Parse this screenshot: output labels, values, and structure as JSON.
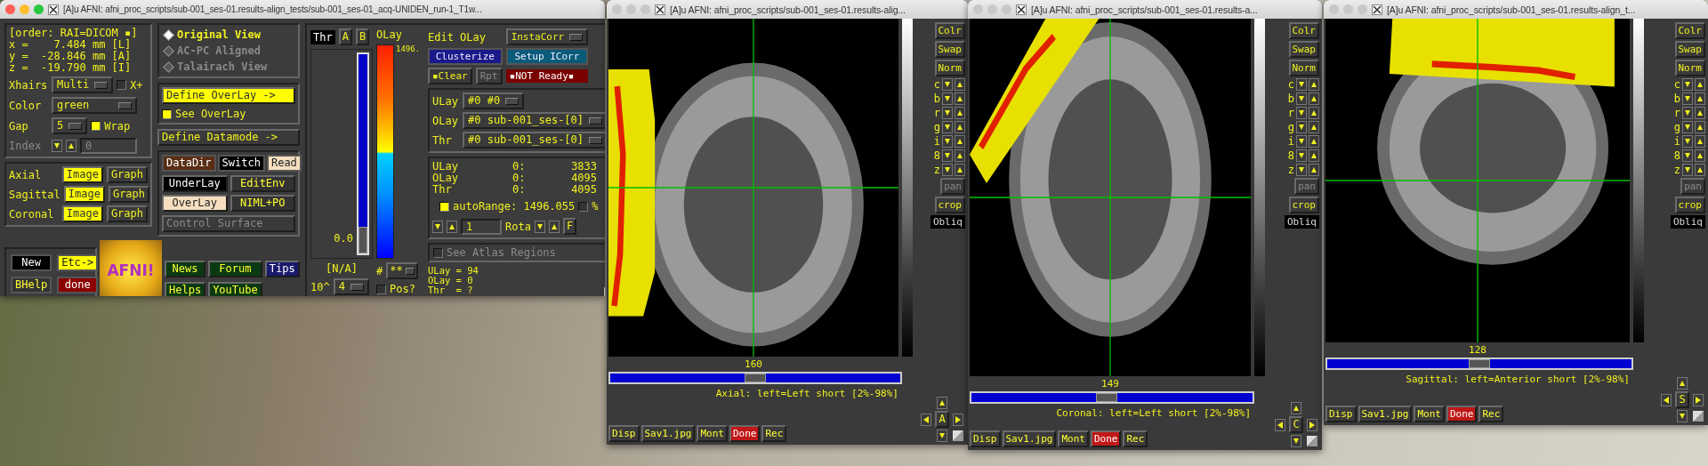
{
  "main_window": {
    "title": "[A]u AFNI: afni_proc_scripts/sub-001_ses-01.results-align_tests/sub-001_ses-01_acq-UNIDEN_run-1_T1w...",
    "coordinates": {
      "order": "[order: RAI=DICOM ▪]",
      "lines": [
        "x =    7.484 mm [L]",
        "y =  -28.846 mm [A]",
        "z =  -19.790 mm [I]"
      ]
    },
    "xhairs": {
      "label": "Xhairs",
      "value": "Multi",
      "option": {
        "label": "X+",
        "checked": false
      }
    },
    "color": {
      "label": "Color",
      "value": "green"
    },
    "gap": {
      "label": "Gap",
      "value": "5",
      "option": {
        "label": "Wrap",
        "checked": true
      }
    },
    "index": {
      "label": "Index",
      "value": "0",
      "disabled": true
    },
    "planes": [
      {
        "label": "Axial",
        "image": {
          "label": "Image",
          "on": true
        },
        "graph": {
          "label": "Graph",
          "on": false
        }
      },
      {
        "label": "Sagittal",
        "image": {
          "label": "Image",
          "on": true
        },
        "graph": {
          "label": "Graph",
          "on": false
        }
      },
      {
        "label": "Coronal",
        "image": {
          "label": "Image",
          "on": true
        },
        "graph": {
          "label": "Graph",
          "on": false
        }
      }
    ],
    "views": [
      {
        "label": "Original View",
        "selected": true,
        "disabled": false
      },
      {
        "label": "AC-PC Aligned",
        "selected": false,
        "disabled": true
      },
      {
        "label": "Talairach View",
        "selected": false,
        "disabled": true
      }
    ],
    "define_overlay": {
      "label": "Define OverLay ->",
      "on": true
    },
    "see_overlay": {
      "label": "See OverLay",
      "checked": true
    },
    "define_datamode": {
      "label": "Define Datamode ->"
    },
    "datamode_buttons": [
      {
        "label": "DataDir",
        "color": "#5a2e14"
      },
      {
        "label": "Switch",
        "color": "#000000"
      },
      {
        "label": "Read",
        "color": "#f5dfc0"
      }
    ],
    "layer_buttons": [
      {
        "label": "UnderLay",
        "color": "#000000"
      },
      {
        "label": "EditEnv",
        "color": "#333333"
      },
      {
        "label": "OverLay",
        "color": "#f5dfc0"
      },
      {
        "label": "NIML+PO",
        "color": "#333333"
      }
    ],
    "control_surface": {
      "label": "Control Surface",
      "disabled": true
    },
    "session_buttons": [
      {
        "label": "New",
        "color": "#000000"
      },
      {
        "label": "Etc->",
        "color": "#ffff00"
      },
      {
        "label": "BHelp",
        "color": "#333333"
      },
      {
        "label": "done",
        "color": "#8b0000"
      }
    ],
    "logo": {
      "text": "AFNI!"
    },
    "help_links": [
      {
        "label": "News",
        "color": "#0b3a12"
      },
      {
        "label": "Forum",
        "color": "#0b3a12"
      },
      {
        "label": "Tips",
        "color": "#1a1a6e"
      },
      {
        "label": "Helps",
        "color": "#0b3a12"
      },
      {
        "label": "YouTube",
        "color": "#0b3a12"
      }
    ],
    "threshold": {
      "label": "Thr",
      "buttons": [
        "A",
        "B"
      ],
      "level": 0,
      "reading": "0.0",
      "pvalue": "[N/A]",
      "exponent_label": "10^",
      "exponent": "4"
    },
    "overlay_bar": {
      "label": "OLay",
      "top_value": "1496.",
      "count_label": "#",
      "count": "**",
      "pos": {
        "label": "Pos?",
        "checked": false
      }
    },
    "edit_overlay": {
      "label": "Edit OLay",
      "instacorr": "InstaCorr",
      "clusterize": "Clusterize",
      "setup_icorr": "Setup ICorr",
      "clear": "▪Clear",
      "rpt": {
        "label": "Rpt",
        "disabled": true
      },
      "status": "▪NOT Ready▪"
    },
    "datasets": [
      {
        "label": "ULay",
        "value": "#0 #0"
      },
      {
        "label": "OLay",
        "value": "#0 sub-001_ses-[0]"
      },
      {
        "label": "Thr",
        "value": "#0 sub-001_ses-[0]"
      }
    ],
    "values": [
      {
        "label": "ULay",
        "index": "0:",
        "value": "3833"
      },
      {
        "label": "OLay",
        "index": "0:",
        "value": "4095"
      },
      {
        "label": "Thr",
        "index": "0:",
        "value": "4095"
      }
    ],
    "auto_range": {
      "label": "autoRange: 1496.055",
      "checked": true,
      "percent": {
        "label": "%",
        "checked": false
      }
    },
    "rotate": {
      "field": "1",
      "label": "Rota",
      "f_button": "F"
    },
    "atlas": {
      "label": "See Atlas Regions",
      "checked": false,
      "disabled": true
    },
    "readout": [
      "ULay = 94",
      "OLay = 0",
      "Thr  = ?"
    ]
  },
  "viewers": [
    {
      "kind": "axial",
      "title": "[A]u AFNI: afni_proc_scripts/sub-001_ses-01.results-alig...",
      "slice": "160",
      "level": 0.5,
      "caption": "Axial: left=Left short [2%-98%]",
      "nav": "A",
      "tools": [
        {
          "kind": "button",
          "label": "Colr",
          "disabled": false
        },
        {
          "kind": "button",
          "label": "Swap",
          "disabled": false
        },
        {
          "kind": "button",
          "label": "Norm",
          "disabled": false
        },
        {
          "kind": "stepper",
          "label": "c",
          "disabled": false
        },
        {
          "kind": "stepper",
          "label": "b",
          "disabled": false
        },
        {
          "kind": "stepper",
          "label": "r",
          "disabled": false
        },
        {
          "kind": "stepper",
          "label": "g",
          "disabled": false
        },
        {
          "kind": "stepper",
          "label": "i",
          "disabled": false
        },
        {
          "kind": "stepper",
          "label": "8",
          "disabled": false
        },
        {
          "kind": "stepper",
          "label": "z",
          "disabled": false
        },
        {
          "kind": "button",
          "label": "pan",
          "disabled": true
        },
        {
          "kind": "button",
          "label": "crop",
          "disabled": false
        },
        {
          "kind": "label",
          "label": "Obliq",
          "disabled": false
        }
      ],
      "buttons": [
        {
          "label": "Disp",
          "color": "#3a3a3a"
        },
        {
          "label": "Sav1.jpg",
          "color": "#3a3a3a"
        },
        {
          "label": "Mont",
          "color": "#3a3a3a"
        },
        {
          "label": "Done",
          "color": "#c01818"
        },
        {
          "label": "Rec",
          "color": "#3a3a3a"
        }
      ]
    },
    {
      "kind": "coronal",
      "title": "[A]u AFNI: afni_proc_scripts/sub-001_ses-01.results-a...",
      "slice": "149",
      "level": 0.48,
      "caption": "Coronal: left=Left short [2%-98%]",
      "nav": "C",
      "tools": [
        {
          "kind": "button",
          "label": "Colr",
          "disabled": false
        },
        {
          "kind": "button",
          "label": "Swap",
          "disabled": false
        },
        {
          "kind": "button",
          "label": "Norm",
          "disabled": false
        },
        {
          "kind": "stepper",
          "label": "c",
          "disabled": false
        },
        {
          "kind": "stepper",
          "label": "b",
          "disabled": false
        },
        {
          "kind": "stepper",
          "label": "r",
          "disabled": false
        },
        {
          "kind": "stepper",
          "label": "g",
          "disabled": false
        },
        {
          "kind": "stepper",
          "label": "i",
          "disabled": false
        },
        {
          "kind": "stepper",
          "label": "8",
          "disabled": false
        },
        {
          "kind": "stepper",
          "label": "z",
          "disabled": false
        },
        {
          "kind": "button",
          "label": "pan",
          "disabled": true
        },
        {
          "kind": "button",
          "label": "crop",
          "disabled": false
        },
        {
          "kind": "label",
          "label": "Obliq",
          "disabled": false
        }
      ],
      "buttons": [
        {
          "label": "Disp",
          "color": "#3a3a3a"
        },
        {
          "label": "Sav1.jpg",
          "color": "#3a3a3a"
        },
        {
          "label": "Mont",
          "color": "#3a3a3a"
        },
        {
          "label": "Done",
          "color": "#c01818"
        },
        {
          "label": "Rec",
          "color": "#3a3a3a"
        }
      ]
    },
    {
      "kind": "sagittal",
      "title": "[A]u AFNI: afni_proc_scripts/sub-001_ses-01.results-align_t...",
      "slice": "128",
      "level": 0.5,
      "caption": "Sagittal: left=Anterior short [2%-98%]",
      "nav": "S",
      "tools": [
        {
          "kind": "button",
          "label": "Colr",
          "disabled": false
        },
        {
          "kind": "button",
          "label": "Swap",
          "disabled": false
        },
        {
          "kind": "button",
          "label": "Norm",
          "disabled": false
        },
        {
          "kind": "stepper",
          "label": "c",
          "disabled": false
        },
        {
          "kind": "stepper",
          "label": "b",
          "disabled": false
        },
        {
          "kind": "stepper",
          "label": "r",
          "disabled": false
        },
        {
          "kind": "stepper",
          "label": "g",
          "disabled": false
        },
        {
          "kind": "stepper",
          "label": "i",
          "disabled": false
        },
        {
          "kind": "stepper",
          "label": "8",
          "disabled": false
        },
        {
          "kind": "stepper",
          "label": "z",
          "disabled": false
        },
        {
          "kind": "button",
          "label": "pan",
          "disabled": true
        },
        {
          "kind": "button",
          "label": "crop",
          "disabled": false
        },
        {
          "kind": "label",
          "label": "Obliq",
          "disabled": false
        }
      ],
      "buttons": [
        {
          "label": "Disp",
          "color": "#3a3a3a"
        },
        {
          "label": "Sav1.jpg",
          "color": "#3a3a3a"
        },
        {
          "label": "Mont",
          "color": "#3a3a3a"
        },
        {
          "label": "Done",
          "color": "#c01818"
        },
        {
          "label": "Rec",
          "color": "#3a3a3a"
        }
      ]
    }
  ]
}
